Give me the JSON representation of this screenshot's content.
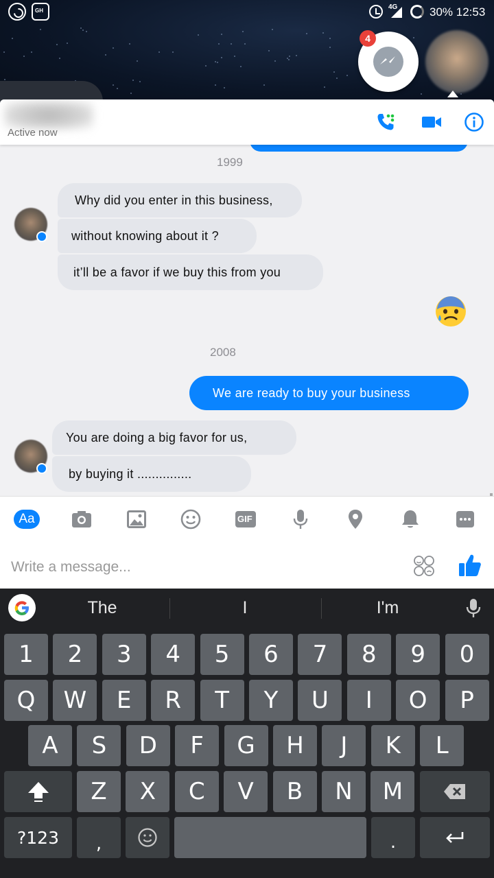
{
  "status_bar": {
    "network": "4G",
    "battery": "30%",
    "time": "12:53"
  },
  "chat_head": {
    "badge_count": "4"
  },
  "header": {
    "active_status": "Active now",
    "icons": [
      "phone-call-icon",
      "video-camera-icon",
      "info-icon"
    ],
    "accent_color": "#0a84ff"
  },
  "messages": {
    "timestamp_1": "1999",
    "in_1": "Why did you enter in this business,",
    "in_2": "without knowing about it ?",
    "in_3": "it’ll be a favor if we buy this from you",
    "timestamp_2": "2008",
    "out_1": "We are ready to buy your business",
    "in_4": "You are doing a big favor for us,",
    "in_5": "by buying it ..............."
  },
  "composer": {
    "aa_label": "Aa",
    "gif_label": "GIF",
    "placeholder": "Write a message...",
    "tools": [
      "camera-icon",
      "image-icon",
      "smiley-icon",
      "gif-icon",
      "mic-icon",
      "location-pin-icon",
      "bell-icon",
      "more-icon"
    ]
  },
  "keyboard": {
    "suggestions": [
      "The",
      "I",
      "I'm"
    ],
    "row_numbers": [
      "1",
      "2",
      "3",
      "4",
      "5",
      "6",
      "7",
      "8",
      "9",
      "0"
    ],
    "row_1": [
      "Q",
      "W",
      "E",
      "R",
      "T",
      "Y",
      "U",
      "I",
      "O",
      "P"
    ],
    "row_2": [
      "A",
      "S",
      "D",
      "F",
      "G",
      "H",
      "J",
      "K",
      "L"
    ],
    "row_3": [
      "Z",
      "X",
      "C",
      "V",
      "B",
      "N",
      "M"
    ],
    "symbols_label": "?123",
    "comma": ",",
    "period": "."
  }
}
